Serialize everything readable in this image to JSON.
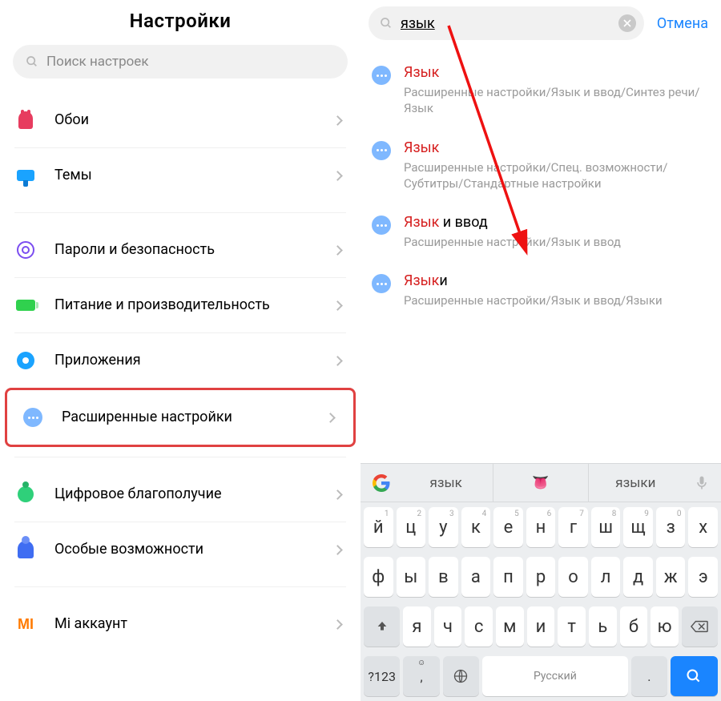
{
  "left": {
    "title": "Настройки",
    "search_placeholder": "Поиск настроек",
    "items": [
      {
        "icon": "tulip-icon",
        "label": "Обои"
      },
      {
        "icon": "brush-icon",
        "label": "Темы"
      },
      {
        "icon": "fingerprint-icon",
        "label": "Пароли и безопасность"
      },
      {
        "icon": "battery-icon",
        "label": "Питание и производительность"
      },
      {
        "icon": "gear-icon",
        "label": "Приложения"
      },
      {
        "icon": "dots-icon",
        "label": "Расширенные настройки"
      },
      {
        "icon": "wellbeing-icon",
        "label": "Цифровое благополучие"
      },
      {
        "icon": "a11y-icon",
        "label": "Особые возможности"
      },
      {
        "icon": "mi-icon",
        "label": "Mi аккаунт"
      }
    ]
  },
  "right": {
    "query": "язык",
    "cancel_label": "Отмена",
    "results": [
      {
        "title_hl": "Язык",
        "title_rest": "",
        "path": "Расширенные настройки/Язык и ввод/Синтез речи/Язык"
      },
      {
        "title_hl": "Язык",
        "title_rest": "",
        "path": "Расширенные настройки/Спец. возможности/Субтитры/Стандартные настройки"
      },
      {
        "title_hl": "Язык",
        "title_rest": " и ввод",
        "path": "Расширенные настройки/Язык и ввод"
      },
      {
        "title_hl": "Язык",
        "title_rest": "и",
        "path": "Расширенные настройки/Язык и ввод/Языки"
      }
    ]
  },
  "keyboard": {
    "suggestions": [
      "язык",
      "языки"
    ],
    "emoji": "👅",
    "row1": [
      "й",
      "ц",
      "у",
      "к",
      "е",
      "н",
      "г",
      "ш",
      "щ",
      "з",
      "х"
    ],
    "row1_nums": [
      "1",
      "2",
      "3",
      "4",
      "5",
      "6",
      "7",
      "8",
      "9",
      "0",
      ""
    ],
    "row2": [
      "ф",
      "ы",
      "в",
      "а",
      "п",
      "р",
      "о",
      "л",
      "д",
      "ж",
      "э"
    ],
    "row3": [
      "я",
      "ч",
      "с",
      "м",
      "и",
      "т",
      "ь",
      "б",
      "ю"
    ],
    "sym_key": "?123",
    "comma": ",",
    "space_label": "Русский",
    "period": "."
  }
}
